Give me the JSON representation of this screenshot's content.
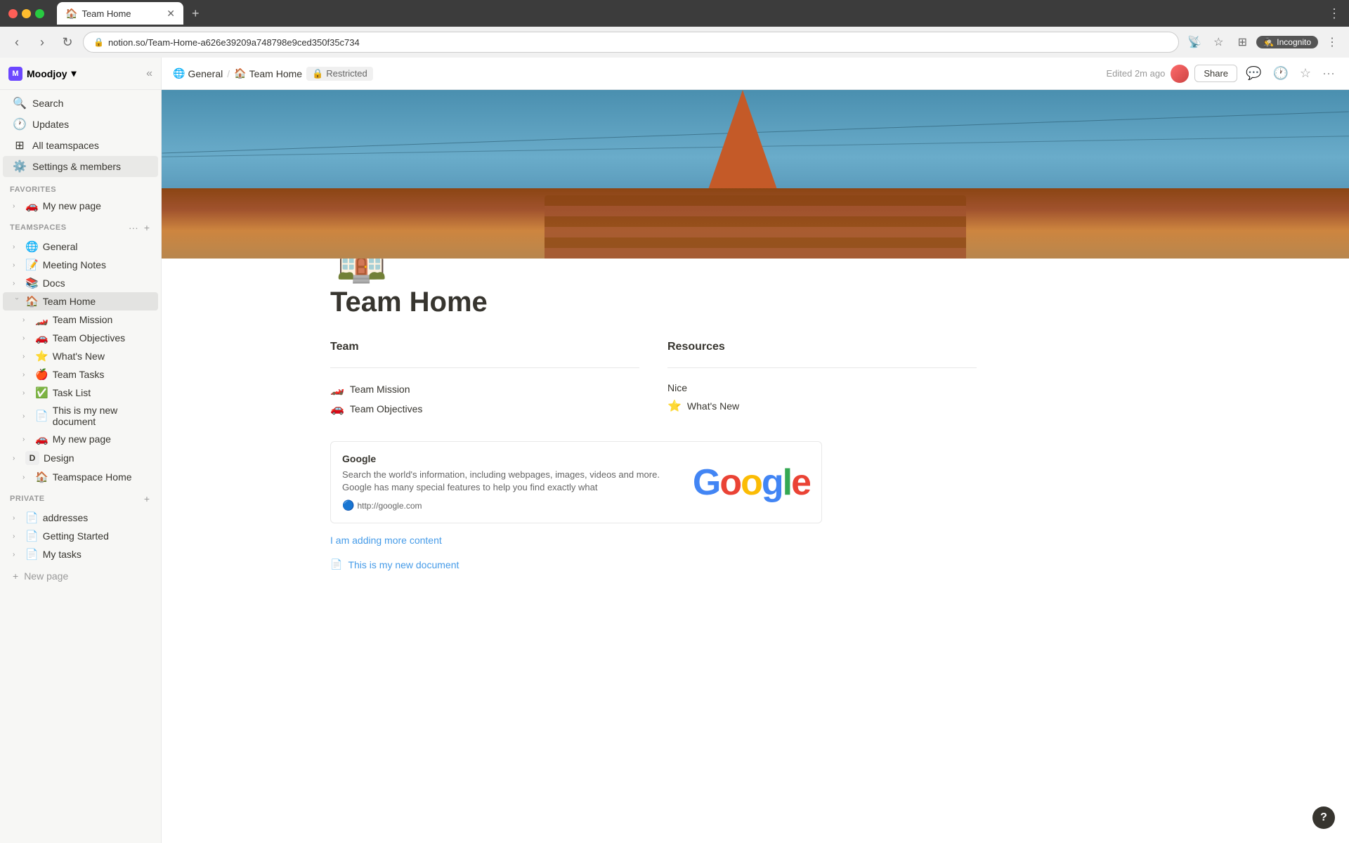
{
  "browser": {
    "tab_title": "Team Home",
    "tab_favicon": "🏠",
    "url": "notion.so/Team-Home-a626e39209a748798e9ced350f35c734",
    "incognito_label": "Incognito",
    "new_tab_label": "+"
  },
  "page_header": {
    "breadcrumb_general": "General",
    "breadcrumb_sep": "/",
    "breadcrumb_page": "Team Home",
    "restricted_label": "Restricted",
    "edited_label": "Edited 2m ago",
    "share_label": "Share"
  },
  "sidebar": {
    "workspace_name": "Moodjoy",
    "workspace_letter": "M",
    "search_label": "Search",
    "updates_label": "Updates",
    "all_teamspaces_label": "All teamspaces",
    "settings_label": "Settings & members",
    "favorites_heading": "Favorites",
    "favorites": [
      {
        "icon": "🚗",
        "label": "My new page"
      }
    ],
    "teamspaces_heading": "Teamspaces",
    "teamspaces": [
      {
        "icon": "🌐",
        "label": "General",
        "active": false
      },
      {
        "icon": "📝",
        "label": "Meeting Notes",
        "active": false
      },
      {
        "icon": "📚",
        "label": "Docs",
        "active": false
      },
      {
        "icon": "🏠",
        "label": "Team Home",
        "active": true,
        "children": [
          {
            "icon": "🏎️",
            "label": "Team Mission"
          },
          {
            "icon": "🚗",
            "label": "Team Objectives"
          },
          {
            "icon": "⭐",
            "label": "What's New"
          },
          {
            "icon": "🍎",
            "label": "Team Tasks"
          },
          {
            "icon": "✅",
            "label": "Task List"
          },
          {
            "icon": "📄",
            "label": "This is my new document"
          },
          {
            "icon": "🚗",
            "label": "My new page"
          }
        ]
      },
      {
        "icon": "D",
        "label": "Design",
        "active": false,
        "letter": true,
        "children": [
          {
            "icon": "🏠",
            "label": "Teamspace Home"
          }
        ]
      }
    ],
    "private_heading": "Private",
    "private_items": [
      {
        "icon": "📄",
        "label": "addresses"
      },
      {
        "icon": "📄",
        "label": "Getting Started"
      },
      {
        "icon": "📄",
        "label": "My tasks"
      }
    ],
    "new_page_label": "New page"
  },
  "page": {
    "icon": "🏠",
    "title": "Team Home",
    "team_col_heading": "Team",
    "resources_col_heading": "Resources",
    "team_links": [
      {
        "icon": "🏎️",
        "label": "Team Mission"
      },
      {
        "icon": "🚗",
        "label": "Team Objectives"
      }
    ],
    "resources_links": [
      {
        "label": "Nice"
      },
      {
        "icon": "⭐",
        "label": "What's New"
      }
    ],
    "bookmark": {
      "title": "Google",
      "description": "Search the world's information, including webpages, images, videos and more. Google has many special features to help you find exactly what",
      "url": "http://google.com",
      "favicon": "🔵"
    },
    "adding_content_link": "I am adding more content",
    "doc_link": "This is my new document",
    "doc_icon": "📄"
  },
  "icons": {
    "chevron_down": "▾",
    "chevron_right": "›",
    "back": "‹",
    "forward": "›",
    "reload": "↻",
    "lock": "🔒",
    "star": "☆",
    "extension": "⊞",
    "profile": "👤",
    "menu": "⋮",
    "collapse": "«",
    "more": "···",
    "plus": "+",
    "restricted": "🔒",
    "chat": "💬",
    "clock": "🕐",
    "bookmark_star": "☆",
    "kebab": "···",
    "question": "?"
  }
}
